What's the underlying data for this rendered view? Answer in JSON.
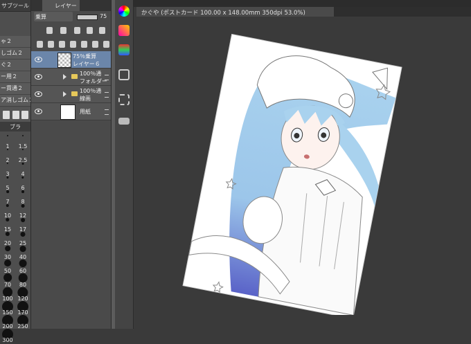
{
  "subtool_panel": {
    "tab_label": "サブツール",
    "items": [
      "ゃ２",
      "しゴム２",
      "ぐ２",
      "ー用２",
      "ー貫通２",
      "ア消しゴム２"
    ],
    "brush_tab_label": "ブラ",
    "brush_sizes": [
      "1",
      "1.5",
      "2",
      "2.5",
      "3",
      "4",
      "5",
      "6",
      "7",
      "8",
      "10",
      "12",
      "15",
      "17",
      "20",
      "25",
      "30",
      "40",
      "50",
      "60",
      "70",
      "80",
      "100",
      "120",
      "150",
      "170",
      "200",
      "250",
      "300"
    ]
  },
  "layer_panel": {
    "tab_label": "レイヤー",
    "blend_mode": "乗算",
    "opacity": "75",
    "layers": [
      {
        "line1": "75％乗算",
        "line2": "レイヤー６",
        "type": "raster",
        "selected": true
      },
      {
        "line1": "100％通",
        "line2": "フォルダー",
        "type": "folder",
        "selected": false
      },
      {
        "line1": "100％通",
        "line2": "線画",
        "type": "folder",
        "selected": false
      },
      {
        "line1": "",
        "line2": "用紙",
        "type": "paper",
        "selected": false
      }
    ]
  },
  "canvas": {
    "title": "かぐや (ポストカード 100.00 x 148.00mm 350dpi 53.0%)"
  },
  "icons": [
    "color-wheel-icon",
    "color-palette-icon",
    "layer-property-icon",
    "navigator-icon",
    "material-icon",
    "folder-open-icon"
  ],
  "colors": {
    "accent": "#6b86aa",
    "panel": "#4a4a4a",
    "canvas_bg": "#3a3a3a"
  }
}
